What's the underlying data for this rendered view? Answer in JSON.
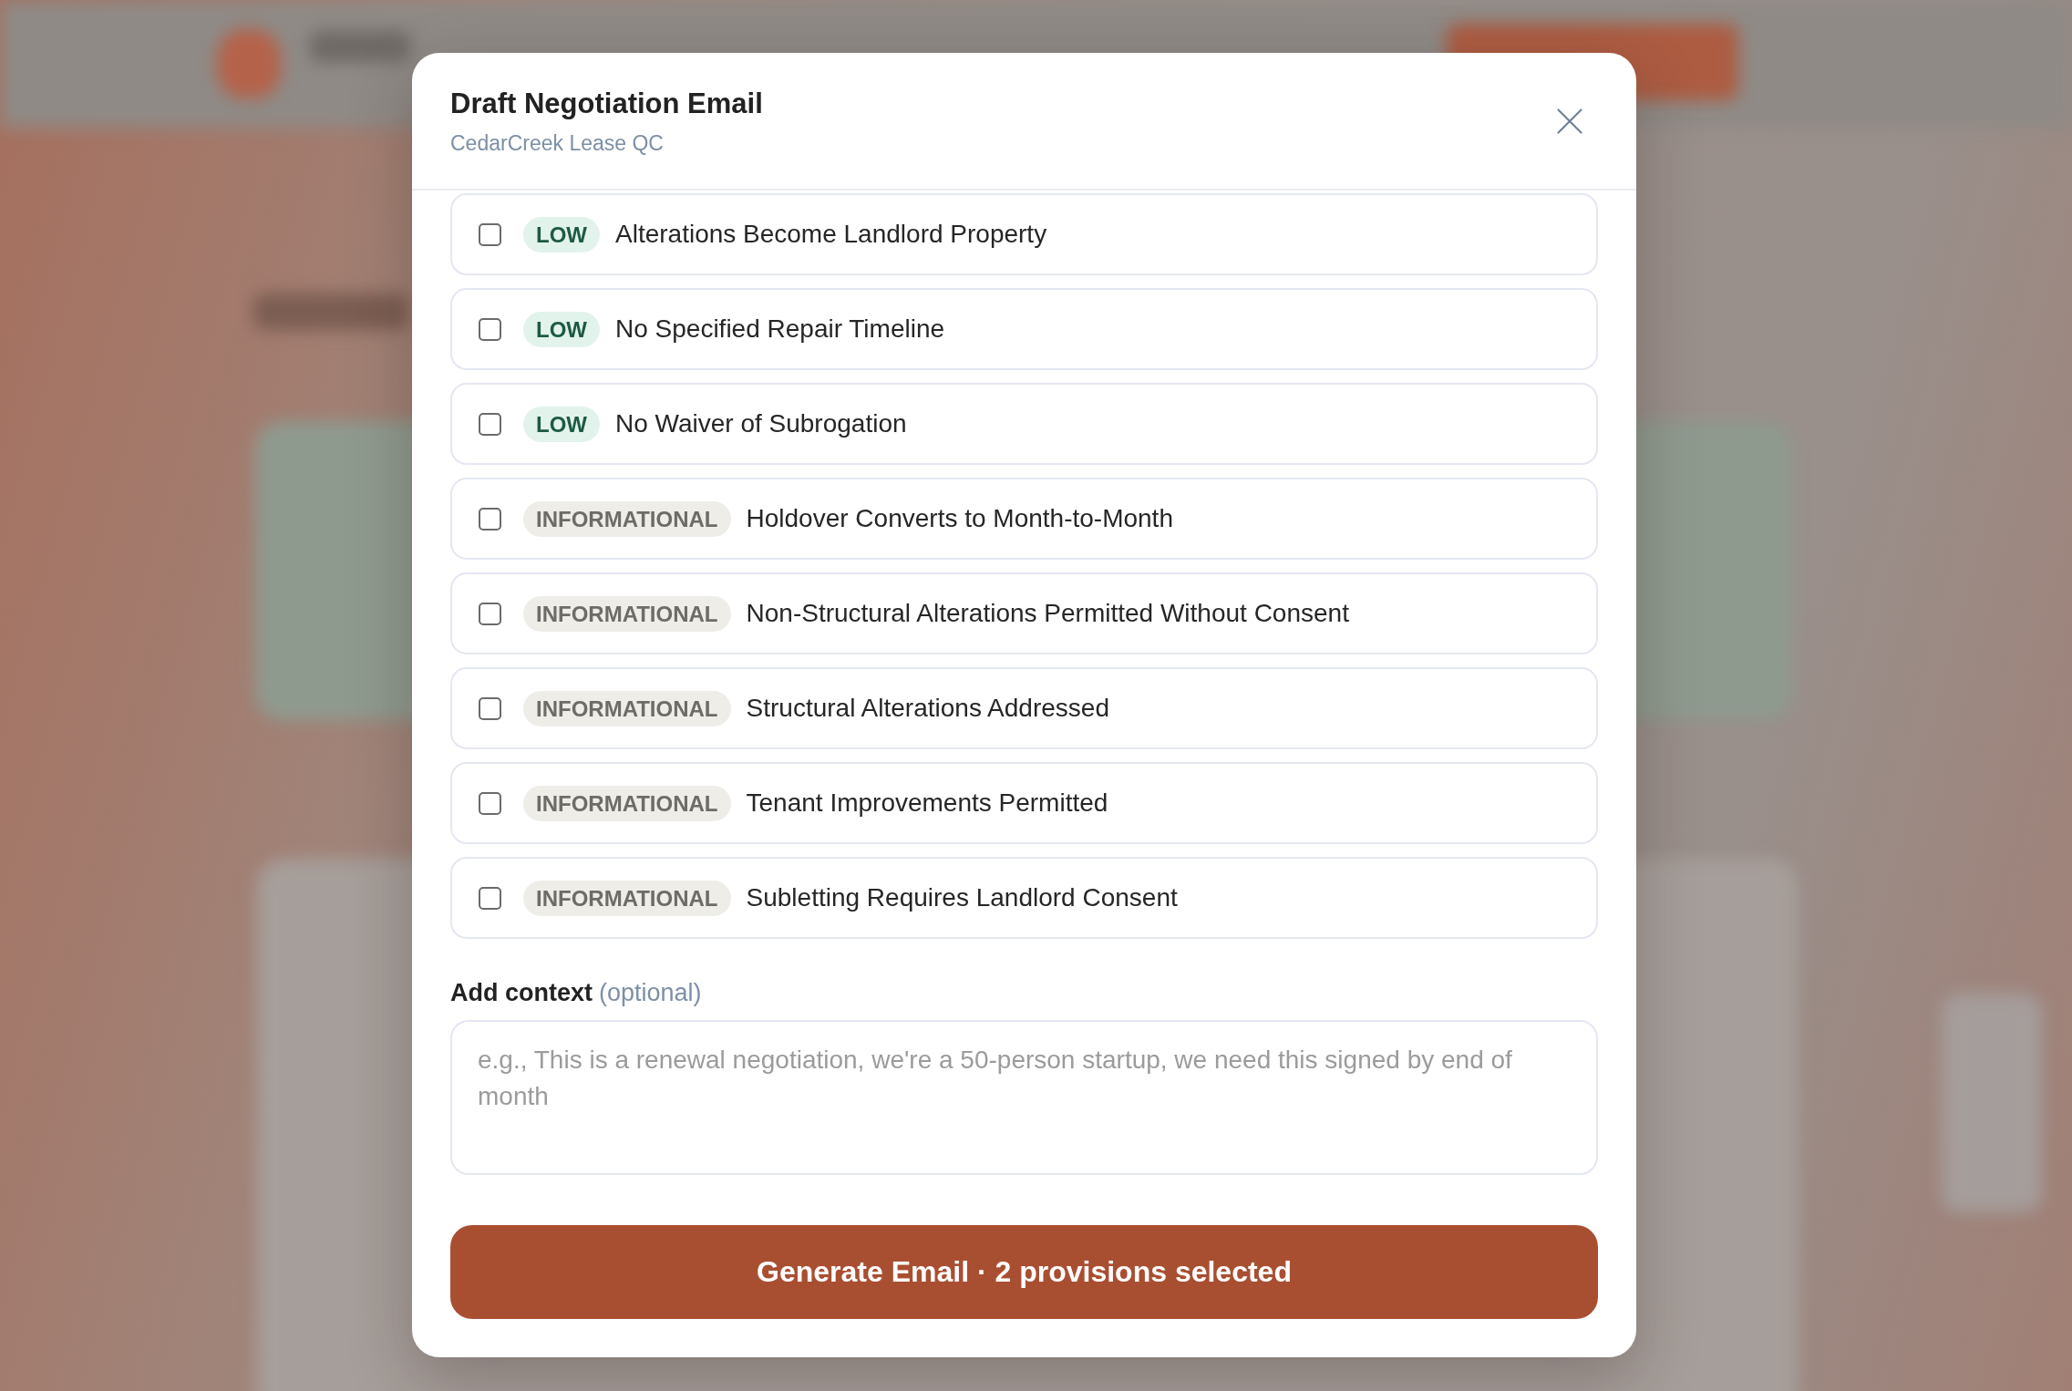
{
  "dialog": {
    "title": "Draft Negotiation Email",
    "subtitle": "CedarCreek Lease QC",
    "provisions": [
      {
        "kind": "low",
        "severity": "LOW",
        "title": "Alterations Become Landlord Property",
        "checked": false
      },
      {
        "kind": "low",
        "severity": "LOW",
        "title": "No Specified Repair Timeline",
        "checked": false
      },
      {
        "kind": "low",
        "severity": "LOW",
        "title": "No Waiver of Subrogation",
        "checked": false
      },
      {
        "kind": "informational",
        "severity": "INFORMATIONAL",
        "title": "Holdover Converts to Month-to-Month",
        "checked": false
      },
      {
        "kind": "informational",
        "severity": "INFORMATIONAL",
        "title": "Non-Structural Alterations Permitted Without Consent",
        "checked": false
      },
      {
        "kind": "informational",
        "severity": "INFORMATIONAL",
        "title": "Structural Alterations Addressed",
        "checked": false
      },
      {
        "kind": "informational",
        "severity": "INFORMATIONAL",
        "title": "Tenant Improvements Permitted",
        "checked": false
      },
      {
        "kind": "informational",
        "severity": "INFORMATIONAL",
        "title": "Subletting Requires Landlord Consent",
        "checked": false
      }
    ],
    "context": {
      "label": "Add context",
      "hint": "(optional)",
      "placeholder": "e.g., This is a renewal negotiation, we're a 50-person startup, we need this signed by end of month"
    },
    "generate_button": "Generate Email · 2 provisions selected"
  }
}
